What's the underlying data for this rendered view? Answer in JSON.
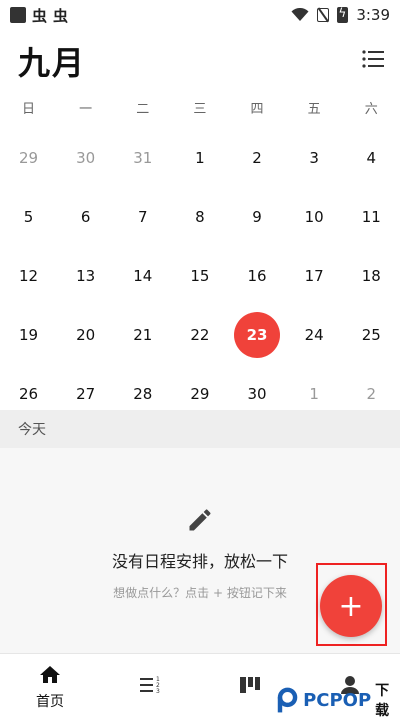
{
  "status_bar": {
    "time": "3:39",
    "app_icon": "square-icon",
    "notifications": [
      "虫",
      "虫"
    ]
  },
  "header": {
    "month_title": "九月",
    "menu_icon": "list-icon"
  },
  "weekdays": [
    "日",
    "一",
    "二",
    "三",
    "四",
    "五",
    "六"
  ],
  "calendar": {
    "weeks": [
      [
        {
          "d": "29",
          "m": true
        },
        {
          "d": "30",
          "m": true
        },
        {
          "d": "31",
          "m": true
        },
        {
          "d": "1"
        },
        {
          "d": "2"
        },
        {
          "d": "3"
        },
        {
          "d": "4"
        }
      ],
      [
        {
          "d": "5"
        },
        {
          "d": "6"
        },
        {
          "d": "7"
        },
        {
          "d": "8"
        },
        {
          "d": "9"
        },
        {
          "d": "10"
        },
        {
          "d": "11"
        }
      ],
      [
        {
          "d": "12"
        },
        {
          "d": "13"
        },
        {
          "d": "14"
        },
        {
          "d": "15"
        },
        {
          "d": "16"
        },
        {
          "d": "17"
        },
        {
          "d": "18"
        }
      ],
      [
        {
          "d": "19"
        },
        {
          "d": "20"
        },
        {
          "d": "21"
        },
        {
          "d": "22"
        },
        {
          "d": "23",
          "today": true
        },
        {
          "d": "24"
        },
        {
          "d": "25"
        }
      ],
      [
        {
          "d": "26"
        },
        {
          "d": "27"
        },
        {
          "d": "28"
        },
        {
          "d": "29"
        },
        {
          "d": "30"
        },
        {
          "d": "1",
          "m": true
        },
        {
          "d": "2",
          "m": true
        }
      ]
    ]
  },
  "today_section": {
    "label": "今天"
  },
  "empty_state": {
    "icon": "pencil-icon",
    "title": "没有日程安排，放松一下",
    "hint": "想做点什么？点击 + 按钮记下来"
  },
  "fab": {
    "label": "+"
  },
  "bottom_nav": {
    "items": [
      {
        "label": "首页",
        "icon": "home-icon"
      },
      {
        "label": "",
        "icon": "list-numbered-icon"
      },
      {
        "label": "",
        "icon": "board-icon"
      },
      {
        "label": "",
        "icon": "profile-icon"
      }
    ]
  },
  "watermark": {
    "brand": "PCPOP",
    "suffix": "下载"
  },
  "colors": {
    "accent": "#f0423a",
    "highlight_frame": "#e22222"
  }
}
